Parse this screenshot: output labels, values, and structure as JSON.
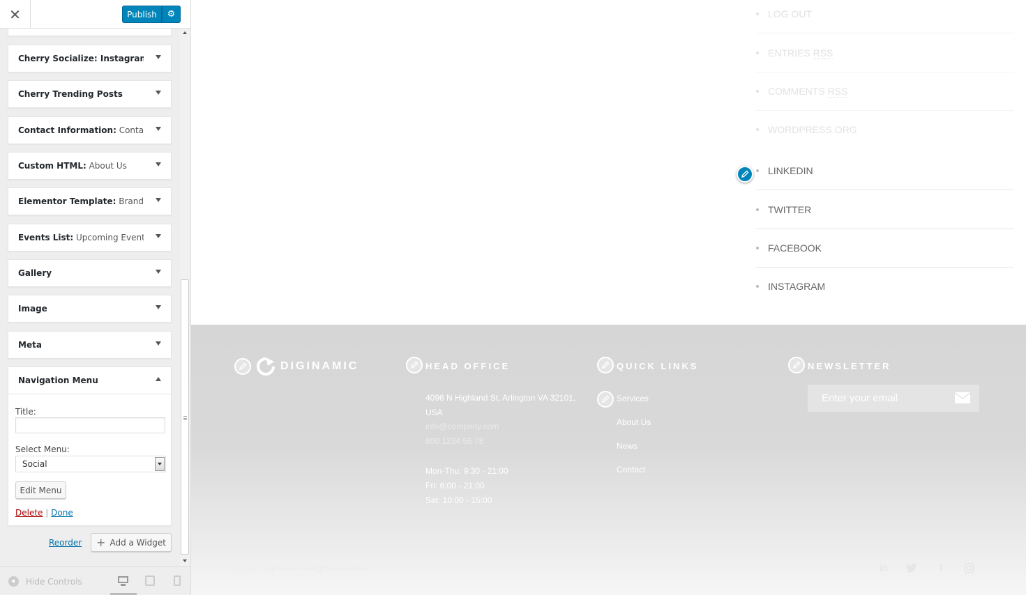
{
  "header": {
    "close_label": "✕",
    "publish_label": "Publish",
    "settings_icon": "gear-icon"
  },
  "widgets": [
    {
      "name": "Cherry Socialize: Instagram: ...",
      "sub": ""
    },
    {
      "name": "Cherry Trending Posts",
      "sub": ""
    },
    {
      "name": "Contact Information:",
      "sub": " Contac..."
    },
    {
      "name": "Custom HTML:",
      "sub": " About Us"
    },
    {
      "name": "Elementor Template:",
      "sub": " Brands"
    },
    {
      "name": "Events List:",
      "sub": " Upcoming Events"
    },
    {
      "name": "Gallery",
      "sub": ""
    },
    {
      "name": "Image",
      "sub": ""
    },
    {
      "name": "Meta",
      "sub": ""
    }
  ],
  "nav_widget": {
    "name": "Navigation Menu",
    "title_label": "Title:",
    "title_value": "",
    "select_label": "Select Menu:",
    "selected_menu": "Social",
    "edit_menu_label": "Edit Menu",
    "delete_label": "Delete",
    "separator": "|",
    "done_label": "Done"
  },
  "sidebar_actions": {
    "reorder_label": "Reorder",
    "add_widget_label": "Add a Widget"
  },
  "sidebar_footer": {
    "hide_controls_label": "Hide Controls",
    "devices": [
      "desktop-icon",
      "tablet-icon",
      "mobile-icon"
    ]
  },
  "preview": {
    "meta_links": [
      {
        "text": "LOG OUT",
        "rss": ""
      },
      {
        "text": "ENTRIES ",
        "rss": "RSS"
      },
      {
        "text": "COMMENTS ",
        "rss": "RSS"
      },
      {
        "text": "WORDPRESS.ORG",
        "rss": ""
      }
    ],
    "social_menu": [
      "LINKEDIN",
      "TWITTER",
      "FACEBOOK",
      "INSTAGRAM"
    ],
    "footer": {
      "logo_text": "DIGINAMIC",
      "head_office_title": "HEAD OFFICE",
      "address_line1": "4096 N Highland St, Arlington VA 32101,",
      "address_line2": "USA",
      "email": "info@company.com",
      "phone": "800 1234 56 78",
      "hours_1": "Mon-Thu: 9:30 - 21:00",
      "hours_2": "Fri: 6:00 - 21:00",
      "hours_3": "Sat: 10:00 - 15:00",
      "quick_links_title": "QUICK LINKS",
      "quick_links": [
        "Services",
        "About Us",
        "News",
        "Contact"
      ],
      "newsletter_title": "NEWSLETTER",
      "newsletter_placeholder": "Enter your email",
      "copyright": "© 2017 Diginamic. All Rights Reserved",
      "social_icons": [
        "linkedin-icon",
        "twitter-icon",
        "facebook-icon",
        "instagram-icon"
      ]
    }
  },
  "colors": {
    "publish": "#0085ba",
    "edit_pencil": "#0085ba",
    "delete_link": "#aa0000",
    "link": "#0073aa",
    "footer_bg": "#d6d6d6"
  }
}
